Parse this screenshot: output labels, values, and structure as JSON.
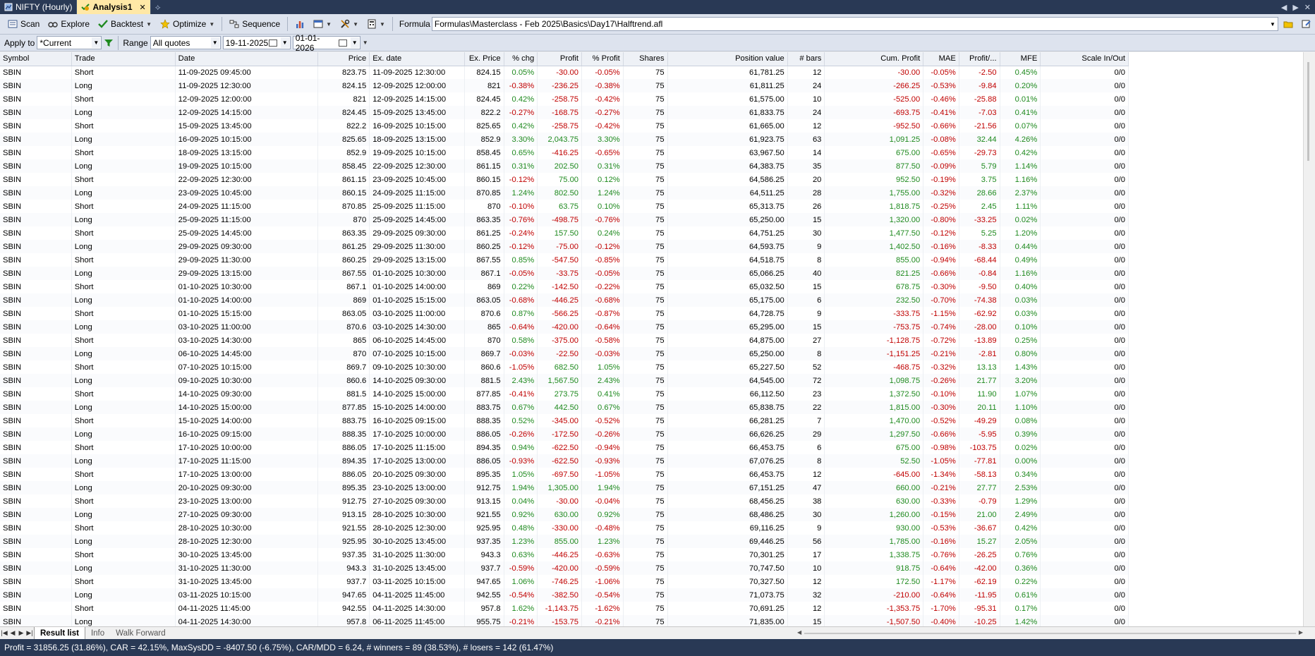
{
  "tabs": [
    {
      "label": "NIFTY (Hourly)",
      "active": false
    },
    {
      "label": "Analysis1",
      "active": true
    }
  ],
  "toolbar": {
    "scan_label": "Scan",
    "explore_label": "Explore",
    "backtest_label": "Backtest",
    "optimize_label": "Optimize",
    "sequence_label": "Sequence",
    "formula_label": "Formula",
    "formula_value": "Formulas\\Masterclass - Feb 2025\\Basics\\Day17\\Halftrend.afl"
  },
  "toolbar2": {
    "apply_to_label": "Apply to",
    "apply_to_value": "*Current",
    "range_label": "Range",
    "range_value": "All quotes",
    "from_date": "19-11-2025",
    "to_date": "01-01-2026"
  },
  "columns": [
    "Symbol",
    "Trade",
    "Date",
    "Price",
    "Ex. date",
    "Ex. Price",
    "% chg",
    "Profit",
    "% Profit",
    "Shares",
    "Position value",
    "# bars",
    "Cum. Profit",
    "MAE",
    "Profit/...",
    "MFE",
    "Scale In/Out"
  ],
  "rows": [
    [
      "SBIN",
      "Short",
      "11-09-2025 09:45:00",
      "823.75",
      "11-09-2025 12:30:00",
      "824.15",
      "0.05%",
      "-30.00",
      "-0.05%",
      "75",
      "61,781.25",
      "12",
      "-30.00",
      "-0.05%",
      "-2.50",
      "0.45%",
      "0/0"
    ],
    [
      "SBIN",
      "Long",
      "11-09-2025 12:30:00",
      "824.15",
      "12-09-2025 12:00:00",
      "821",
      "-0.38%",
      "-236.25",
      "-0.38%",
      "75",
      "61,811.25",
      "24",
      "-266.25",
      "-0.53%",
      "-9.84",
      "0.20%",
      "0/0"
    ],
    [
      "SBIN",
      "Short",
      "12-09-2025 12:00:00",
      "821",
      "12-09-2025 14:15:00",
      "824.45",
      "0.42%",
      "-258.75",
      "-0.42%",
      "75",
      "61,575.00",
      "10",
      "-525.00",
      "-0.46%",
      "-25.88",
      "0.01%",
      "0/0"
    ],
    [
      "SBIN",
      "Long",
      "12-09-2025 14:15:00",
      "824.45",
      "15-09-2025 13:45:00",
      "822.2",
      "-0.27%",
      "-168.75",
      "-0.27%",
      "75",
      "61,833.75",
      "24",
      "-693.75",
      "-0.41%",
      "-7.03",
      "0.41%",
      "0/0"
    ],
    [
      "SBIN",
      "Short",
      "15-09-2025 13:45:00",
      "822.2",
      "16-09-2025 10:15:00",
      "825.65",
      "0.42%",
      "-258.75",
      "-0.42%",
      "75",
      "61,665.00",
      "12",
      "-952.50",
      "-0.66%",
      "-21.56",
      "0.07%",
      "0/0"
    ],
    [
      "SBIN",
      "Long",
      "16-09-2025 10:15:00",
      "825.65",
      "18-09-2025 13:15:00",
      "852.9",
      "3.30%",
      "2,043.75",
      "3.30%",
      "75",
      "61,923.75",
      "63",
      "1,091.25",
      "-0.08%",
      "32.44",
      "4.26%",
      "0/0"
    ],
    [
      "SBIN",
      "Short",
      "18-09-2025 13:15:00",
      "852.9",
      "19-09-2025 10:15:00",
      "858.45",
      "0.65%",
      "-416.25",
      "-0.65%",
      "75",
      "63,967.50",
      "14",
      "675.00",
      "-0.65%",
      "-29.73",
      "0.42%",
      "0/0"
    ],
    [
      "SBIN",
      "Long",
      "19-09-2025 10:15:00",
      "858.45",
      "22-09-2025 12:30:00",
      "861.15",
      "0.31%",
      "202.50",
      "0.31%",
      "75",
      "64,383.75",
      "35",
      "877.50",
      "-0.09%",
      "5.79",
      "1.14%",
      "0/0"
    ],
    [
      "SBIN",
      "Short",
      "22-09-2025 12:30:00",
      "861.15",
      "23-09-2025 10:45:00",
      "860.15",
      "-0.12%",
      "75.00",
      "0.12%",
      "75",
      "64,586.25",
      "20",
      "952.50",
      "-0.19%",
      "3.75",
      "1.16%",
      "0/0"
    ],
    [
      "SBIN",
      "Long",
      "23-09-2025 10:45:00",
      "860.15",
      "24-09-2025 11:15:00",
      "870.85",
      "1.24%",
      "802.50",
      "1.24%",
      "75",
      "64,511.25",
      "28",
      "1,755.00",
      "-0.32%",
      "28.66",
      "2.37%",
      "0/0"
    ],
    [
      "SBIN",
      "Short",
      "24-09-2025 11:15:00",
      "870.85",
      "25-09-2025 11:15:00",
      "870",
      "-0.10%",
      "63.75",
      "0.10%",
      "75",
      "65,313.75",
      "26",
      "1,818.75",
      "-0.25%",
      "2.45",
      "1.11%",
      "0/0"
    ],
    [
      "SBIN",
      "Long",
      "25-09-2025 11:15:00",
      "870",
      "25-09-2025 14:45:00",
      "863.35",
      "-0.76%",
      "-498.75",
      "-0.76%",
      "75",
      "65,250.00",
      "15",
      "1,320.00",
      "-0.80%",
      "-33.25",
      "0.02%",
      "0/0"
    ],
    [
      "SBIN",
      "Short",
      "25-09-2025 14:45:00",
      "863.35",
      "29-09-2025 09:30:00",
      "861.25",
      "-0.24%",
      "157.50",
      "0.24%",
      "75",
      "64,751.25",
      "30",
      "1,477.50",
      "-0.12%",
      "5.25",
      "1.20%",
      "0/0"
    ],
    [
      "SBIN",
      "Long",
      "29-09-2025 09:30:00",
      "861.25",
      "29-09-2025 11:30:00",
      "860.25",
      "-0.12%",
      "-75.00",
      "-0.12%",
      "75",
      "64,593.75",
      "9",
      "1,402.50",
      "-0.16%",
      "-8.33",
      "0.44%",
      "0/0"
    ],
    [
      "SBIN",
      "Short",
      "29-09-2025 11:30:00",
      "860.25",
      "29-09-2025 13:15:00",
      "867.55",
      "0.85%",
      "-547.50",
      "-0.85%",
      "75",
      "64,518.75",
      "8",
      "855.00",
      "-0.94%",
      "-68.44",
      "0.49%",
      "0/0"
    ],
    [
      "SBIN",
      "Long",
      "29-09-2025 13:15:00",
      "867.55",
      "01-10-2025 10:30:00",
      "867.1",
      "-0.05%",
      "-33.75",
      "-0.05%",
      "75",
      "65,066.25",
      "40",
      "821.25",
      "-0.66%",
      "-0.84",
      "1.16%",
      "0/0"
    ],
    [
      "SBIN",
      "Short",
      "01-10-2025 10:30:00",
      "867.1",
      "01-10-2025 14:00:00",
      "869",
      "0.22%",
      "-142.50",
      "-0.22%",
      "75",
      "65,032.50",
      "15",
      "678.75",
      "-0.30%",
      "-9.50",
      "0.40%",
      "0/0"
    ],
    [
      "SBIN",
      "Long",
      "01-10-2025 14:00:00",
      "869",
      "01-10-2025 15:15:00",
      "863.05",
      "-0.68%",
      "-446.25",
      "-0.68%",
      "75",
      "65,175.00",
      "6",
      "232.50",
      "-0.70%",
      "-74.38",
      "0.03%",
      "0/0"
    ],
    [
      "SBIN",
      "Short",
      "01-10-2025 15:15:00",
      "863.05",
      "03-10-2025 11:00:00",
      "870.6",
      "0.87%",
      "-566.25",
      "-0.87%",
      "75",
      "64,728.75",
      "9",
      "-333.75",
      "-1.15%",
      "-62.92",
      "0.03%",
      "0/0"
    ],
    [
      "SBIN",
      "Long",
      "03-10-2025 11:00:00",
      "870.6",
      "03-10-2025 14:30:00",
      "865",
      "-0.64%",
      "-420.00",
      "-0.64%",
      "75",
      "65,295.00",
      "15",
      "-753.75",
      "-0.74%",
      "-28.00",
      "0.10%",
      "0/0"
    ],
    [
      "SBIN",
      "Short",
      "03-10-2025 14:30:00",
      "865",
      "06-10-2025 14:45:00",
      "870",
      "0.58%",
      "-375.00",
      "-0.58%",
      "75",
      "64,875.00",
      "27",
      "-1,128.75",
      "-0.72%",
      "-13.89",
      "0.25%",
      "0/0"
    ],
    [
      "SBIN",
      "Long",
      "06-10-2025 14:45:00",
      "870",
      "07-10-2025 10:15:00",
      "869.7",
      "-0.03%",
      "-22.50",
      "-0.03%",
      "75",
      "65,250.00",
      "8",
      "-1,151.25",
      "-0.21%",
      "-2.81",
      "0.80%",
      "0/0"
    ],
    [
      "SBIN",
      "Short",
      "07-10-2025 10:15:00",
      "869.7",
      "09-10-2025 10:30:00",
      "860.6",
      "-1.05%",
      "682.50",
      "1.05%",
      "75",
      "65,227.50",
      "52",
      "-468.75",
      "-0.32%",
      "13.13",
      "1.43%",
      "0/0"
    ],
    [
      "SBIN",
      "Long",
      "09-10-2025 10:30:00",
      "860.6",
      "14-10-2025 09:30:00",
      "881.5",
      "2.43%",
      "1,567.50",
      "2.43%",
      "75",
      "64,545.00",
      "72",
      "1,098.75",
      "-0.26%",
      "21.77",
      "3.20%",
      "0/0"
    ],
    [
      "SBIN",
      "Short",
      "14-10-2025 09:30:00",
      "881.5",
      "14-10-2025 15:00:00",
      "877.85",
      "-0.41%",
      "273.75",
      "0.41%",
      "75",
      "66,112.50",
      "23",
      "1,372.50",
      "-0.10%",
      "11.90",
      "1.07%",
      "0/0"
    ],
    [
      "SBIN",
      "Long",
      "14-10-2025 15:00:00",
      "877.85",
      "15-10-2025 14:00:00",
      "883.75",
      "0.67%",
      "442.50",
      "0.67%",
      "75",
      "65,838.75",
      "22",
      "1,815.00",
      "-0.30%",
      "20.11",
      "1.10%",
      "0/0"
    ],
    [
      "SBIN",
      "Short",
      "15-10-2025 14:00:00",
      "883.75",
      "16-10-2025 09:15:00",
      "888.35",
      "0.52%",
      "-345.00",
      "-0.52%",
      "75",
      "66,281.25",
      "7",
      "1,470.00",
      "-0.52%",
      "-49.29",
      "0.08%",
      "0/0"
    ],
    [
      "SBIN",
      "Long",
      "16-10-2025 09:15:00",
      "888.35",
      "17-10-2025 10:00:00",
      "886.05",
      "-0.26%",
      "-172.50",
      "-0.26%",
      "75",
      "66,626.25",
      "29",
      "1,297.50",
      "-0.66%",
      "-5.95",
      "0.39%",
      "0/0"
    ],
    [
      "SBIN",
      "Short",
      "17-10-2025 10:00:00",
      "886.05",
      "17-10-2025 11:15:00",
      "894.35",
      "0.94%",
      "-622.50",
      "-0.94%",
      "75",
      "66,453.75",
      "6",
      "675.00",
      "-0.98%",
      "-103.75",
      "0.02%",
      "0/0"
    ],
    [
      "SBIN",
      "Long",
      "17-10-2025 11:15:00",
      "894.35",
      "17-10-2025 13:00:00",
      "886.05",
      "-0.93%",
      "-622.50",
      "-0.93%",
      "75",
      "67,076.25",
      "8",
      "52.50",
      "-1.05%",
      "-77.81",
      "0.00%",
      "0/0"
    ],
    [
      "SBIN",
      "Short",
      "17-10-2025 13:00:00",
      "886.05",
      "20-10-2025 09:30:00",
      "895.35",
      "1.05%",
      "-697.50",
      "-1.05%",
      "75",
      "66,453.75",
      "12",
      "-645.00",
      "-1.34%",
      "-58.13",
      "0.34%",
      "0/0"
    ],
    [
      "SBIN",
      "Long",
      "20-10-2025 09:30:00",
      "895.35",
      "23-10-2025 13:00:00",
      "912.75",
      "1.94%",
      "1,305.00",
      "1.94%",
      "75",
      "67,151.25",
      "47",
      "660.00",
      "-0.21%",
      "27.77",
      "2.53%",
      "0/0"
    ],
    [
      "SBIN",
      "Short",
      "23-10-2025 13:00:00",
      "912.75",
      "27-10-2025 09:30:00",
      "913.15",
      "0.04%",
      "-30.00",
      "-0.04%",
      "75",
      "68,456.25",
      "38",
      "630.00",
      "-0.33%",
      "-0.79",
      "1.29%",
      "0/0"
    ],
    [
      "SBIN",
      "Long",
      "27-10-2025 09:30:00",
      "913.15",
      "28-10-2025 10:30:00",
      "921.55",
      "0.92%",
      "630.00",
      "0.92%",
      "75",
      "68,486.25",
      "30",
      "1,260.00",
      "-0.15%",
      "21.00",
      "2.49%",
      "0/0"
    ],
    [
      "SBIN",
      "Short",
      "28-10-2025 10:30:00",
      "921.55",
      "28-10-2025 12:30:00",
      "925.95",
      "0.48%",
      "-330.00",
      "-0.48%",
      "75",
      "69,116.25",
      "9",
      "930.00",
      "-0.53%",
      "-36.67",
      "0.42%",
      "0/0"
    ],
    [
      "SBIN",
      "Long",
      "28-10-2025 12:30:00",
      "925.95",
      "30-10-2025 13:45:00",
      "937.35",
      "1.23%",
      "855.00",
      "1.23%",
      "75",
      "69,446.25",
      "56",
      "1,785.00",
      "-0.16%",
      "15.27",
      "2.05%",
      "0/0"
    ],
    [
      "SBIN",
      "Short",
      "30-10-2025 13:45:00",
      "937.35",
      "31-10-2025 11:30:00",
      "943.3",
      "0.63%",
      "-446.25",
      "-0.63%",
      "75",
      "70,301.25",
      "17",
      "1,338.75",
      "-0.76%",
      "-26.25",
      "0.76%",
      "0/0"
    ],
    [
      "SBIN",
      "Long",
      "31-10-2025 11:30:00",
      "943.3",
      "31-10-2025 13:45:00",
      "937.7",
      "-0.59%",
      "-420.00",
      "-0.59%",
      "75",
      "70,747.50",
      "10",
      "918.75",
      "-0.64%",
      "-42.00",
      "0.36%",
      "0/0"
    ],
    [
      "SBIN",
      "Short",
      "31-10-2025 13:45:00",
      "937.7",
      "03-11-2025 10:15:00",
      "947.65",
      "1.06%",
      "-746.25",
      "-1.06%",
      "75",
      "70,327.50",
      "12",
      "172.50",
      "-1.17%",
      "-62.19",
      "0.22%",
      "0/0"
    ],
    [
      "SBIN",
      "Long",
      "03-11-2025 10:15:00",
      "947.65",
      "04-11-2025 11:45:00",
      "942.55",
      "-0.54%",
      "-382.50",
      "-0.54%",
      "75",
      "71,073.75",
      "32",
      "-210.00",
      "-0.64%",
      "-11.95",
      "0.61%",
      "0/0"
    ],
    [
      "SBIN",
      "Short",
      "04-11-2025 11:45:00",
      "942.55",
      "04-11-2025 14:30:00",
      "957.8",
      "1.62%",
      "-1,143.75",
      "-1.62%",
      "75",
      "70,691.25",
      "12",
      "-1,353.75",
      "-1.70%",
      "-95.31",
      "0.17%",
      "0/0"
    ],
    [
      "SBIN",
      "Long",
      "04-11-2025 14:30:00",
      "957.8",
      "06-11-2025 11:45:00",
      "955.75",
      "-0.21%",
      "-153.75",
      "-0.21%",
      "75",
      "71,835.00",
      "15",
      "-1,507.50",
      "-0.40%",
      "-10.25",
      "1.42%",
      "0/0"
    ]
  ],
  "bottom_tabs": [
    {
      "label": "Result list",
      "active": true
    },
    {
      "label": "Info",
      "active": false
    },
    {
      "label": "Walk Forward",
      "active": false
    }
  ],
  "status_text": "Profit = 31856.25 (31.86%), CAR = 42.15%, MaxSysDD = -8407.50 (-6.75%), CAR/MDD = 6.24, # winners = 89 (38.53%), # losers = 142 (61.47%)",
  "colors": {
    "positive": "#1f8a1f",
    "negative": "#c00000",
    "titlebar": "#293955",
    "active_tab": "#ffe8a6"
  },
  "icons": [
    "document-icon",
    "analysis-icon",
    "close-icon",
    "pin-icon",
    "scan-icon",
    "explore-icon",
    "backtest-icon",
    "optimize-icon",
    "report-icon",
    "sequence-icon",
    "chart-icon",
    "settings-icon",
    "filter-icon",
    "calendar-icon",
    "open-folder-icon"
  ]
}
